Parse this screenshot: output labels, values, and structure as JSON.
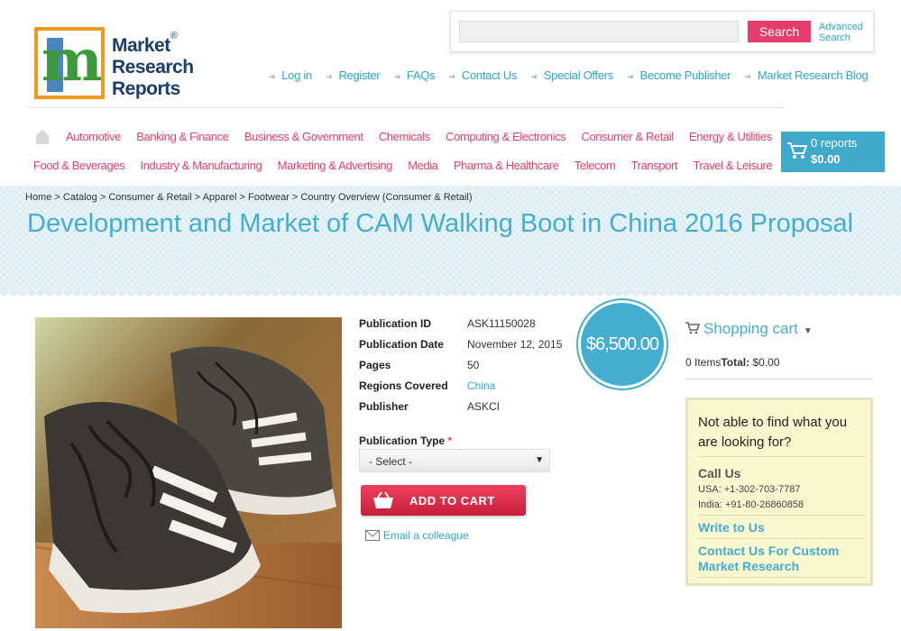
{
  "brand": {
    "logo_line1": "Market",
    "logo_line2": "Research",
    "logo_line3": "Reports",
    "logo_mark": "m",
    "registered": "®"
  },
  "search": {
    "placeholder": "",
    "button_label": "Search",
    "advanced_line1": "Advanced",
    "advanced_line2": "Search"
  },
  "top_links": [
    "Log in",
    "Register",
    "FAQs",
    "Contact Us",
    "Special Offers",
    "Become Publisher",
    "Market Research Blog"
  ],
  "categories_row1": [
    "Automotive",
    "Banking & Finance",
    "Business & Government",
    "Chemicals",
    "Computing & Electronics",
    "Consumer & Retail",
    "Energy & Utilities"
  ],
  "categories_row2": [
    "Food & Beverages",
    "Industry & Manufacturing",
    "Marketing & Advertising",
    "Media",
    "Pharma & Healthcare",
    "Telecom",
    "Transport",
    "Travel & Leisure"
  ],
  "cart": {
    "reports": "0 reports",
    "total": "$0.00"
  },
  "breadcrumb": "Home > Catalog > Consumer & Retail > Apparel > Footwear > Country Overview (Consumer & Retail)",
  "page_title": "Development and Market of CAM Walking Boot in China 2016 Proposal",
  "publication": {
    "rows": [
      {
        "label": "Publication ID",
        "value": "ASK11150028"
      },
      {
        "label": "Publication Date",
        "value": "November 12, 2015"
      },
      {
        "label": "Pages",
        "value": "50"
      },
      {
        "label": "Regions Covered",
        "value": "China"
      },
      {
        "label": "Publisher",
        "value": "ASKCI"
      }
    ],
    "price": "$6,500.00",
    "type_label": "Publication Type",
    "required_mark": "*",
    "type_selected": "- Select -",
    "add_to_cart": "ADD TO CART",
    "email_colleague": "Email a colleague"
  },
  "shopping_cart": {
    "title": "Shopping cart",
    "items": "0 Items",
    "total_label": "Total:",
    "total_value": "$0.00"
  },
  "help": {
    "question": "Not able to find what you are looking for?",
    "call_us": "Call Us",
    "usa_phone": "USA: +1-302-703-7787",
    "india_phone": "India: +91-80-26860858",
    "write_to_us": "Write to Us",
    "custom_research": "Contact Us For Custom Market Research"
  },
  "colors": {
    "accent_pink": "#e43d6a",
    "accent_blue": "#45aed0",
    "link_blue": "#2aa7c9",
    "help_bg": "#fbf7cf"
  }
}
